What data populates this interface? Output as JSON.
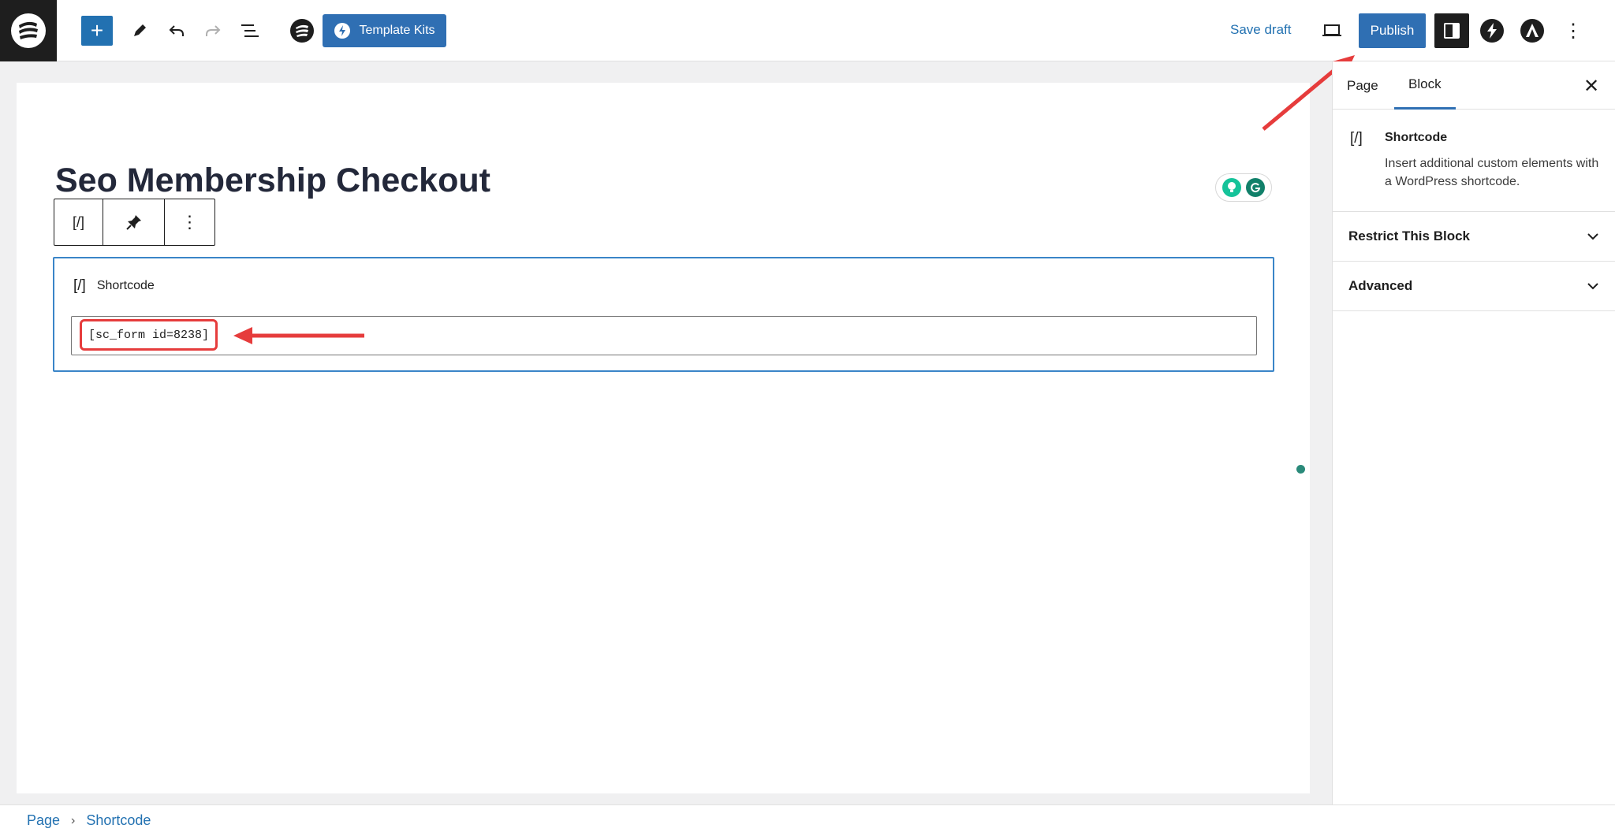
{
  "topbar": {
    "logo_icon": "site-logo-icon",
    "add_block_label": "+",
    "template_kits_label": "Template Kits",
    "save_draft_label": "Save draft",
    "publish_label": "Publish",
    "more_label": "⋮"
  },
  "editor": {
    "page_title": "Seo Membership Checkout",
    "block_toolbar": {
      "block_type_icon": "[/]",
      "more_label": "⋮"
    },
    "shortcode_block": {
      "label": "Shortcode",
      "icon_text": "[/]",
      "value": "[sc_form id=8238]"
    }
  },
  "sidebar": {
    "tabs": [
      {
        "label": "Page"
      },
      {
        "label": "Block"
      }
    ],
    "close_label": "✕",
    "block_card": {
      "icon_text": "[/]",
      "title": "Shortcode",
      "description": "Insert additional custom elements with a WordPress shortcode."
    },
    "panels": [
      {
        "label": "Restrict This Block"
      },
      {
        "label": "Advanced"
      }
    ]
  },
  "breadcrumb": {
    "items": [
      "Page",
      "Shortcode"
    ],
    "separator": "›"
  },
  "colors": {
    "accent": "#2f6fb3",
    "annotation_red": "#e63c3c",
    "dark": "#1e1e1e"
  }
}
